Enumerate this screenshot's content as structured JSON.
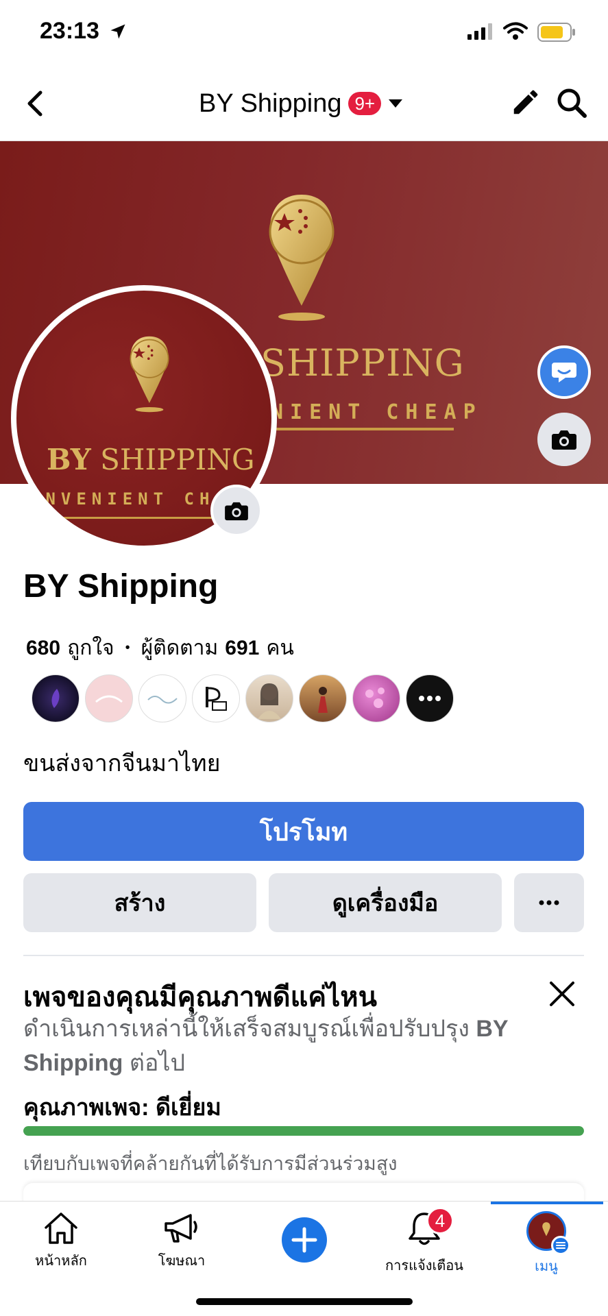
{
  "status_bar": {
    "time": "23:13"
  },
  "header": {
    "title": "BY Shipping",
    "badge": "9+"
  },
  "cover": {
    "brand": "SHIPPING",
    "slogan": "NIENT CHEAP"
  },
  "avatar": {
    "brand_bold": "BY",
    "brand_rest": "SHIPPING",
    "slogan": "ONVENIENT CH"
  },
  "page": {
    "name": "BY Shipping",
    "likes_count": "680",
    "likes_label": "ถูกใจ",
    "separator": "•",
    "followers_label": "ผู้ติดตาม",
    "followers_count": "691",
    "followers_unit": "คน",
    "description": "ขนส่งจากจีนมาไทย"
  },
  "friends": [
    "friend-1",
    "friend-2",
    "friend-3",
    "friend-4",
    "friend-5",
    "friend-6",
    "friend-7"
  ],
  "buttons": {
    "promote": "โปรโมท",
    "create": "สร้าง",
    "tools": "ดูเครื่องมือ",
    "more": "···"
  },
  "quality_card": {
    "title": "เพจของคุณมีคุณภาพดีแค่ไหน",
    "subtitle_pre": "ดำเนินการเหล่านี้ให้เสร็จสมบูรณ์เพื่อปรับปรุง ",
    "subtitle_bold": "BY Shipping",
    "subtitle_post": " ต่อไป",
    "quality_label": "คุณภาพเพจ:",
    "quality_value": "ดีเยี่ยม",
    "quality_level": 1.0,
    "note": "เทียบกับเพจที่คล้ายกันที่ได้รับการมีส่วนร่วมสูง"
  },
  "bottom_nav": {
    "home": "หน้าหลัก",
    "ads": "โฆษณา",
    "notifications": "การแจ้งเตือน",
    "notifications_badge": "4",
    "menu": "เมนู"
  },
  "colors": {
    "brand_blue": "#3d74dd",
    "cover_red": "#7a1c1a",
    "gold": "#d9b45f",
    "quality_green": "#45a251",
    "badge_red": "#e41e3f"
  }
}
